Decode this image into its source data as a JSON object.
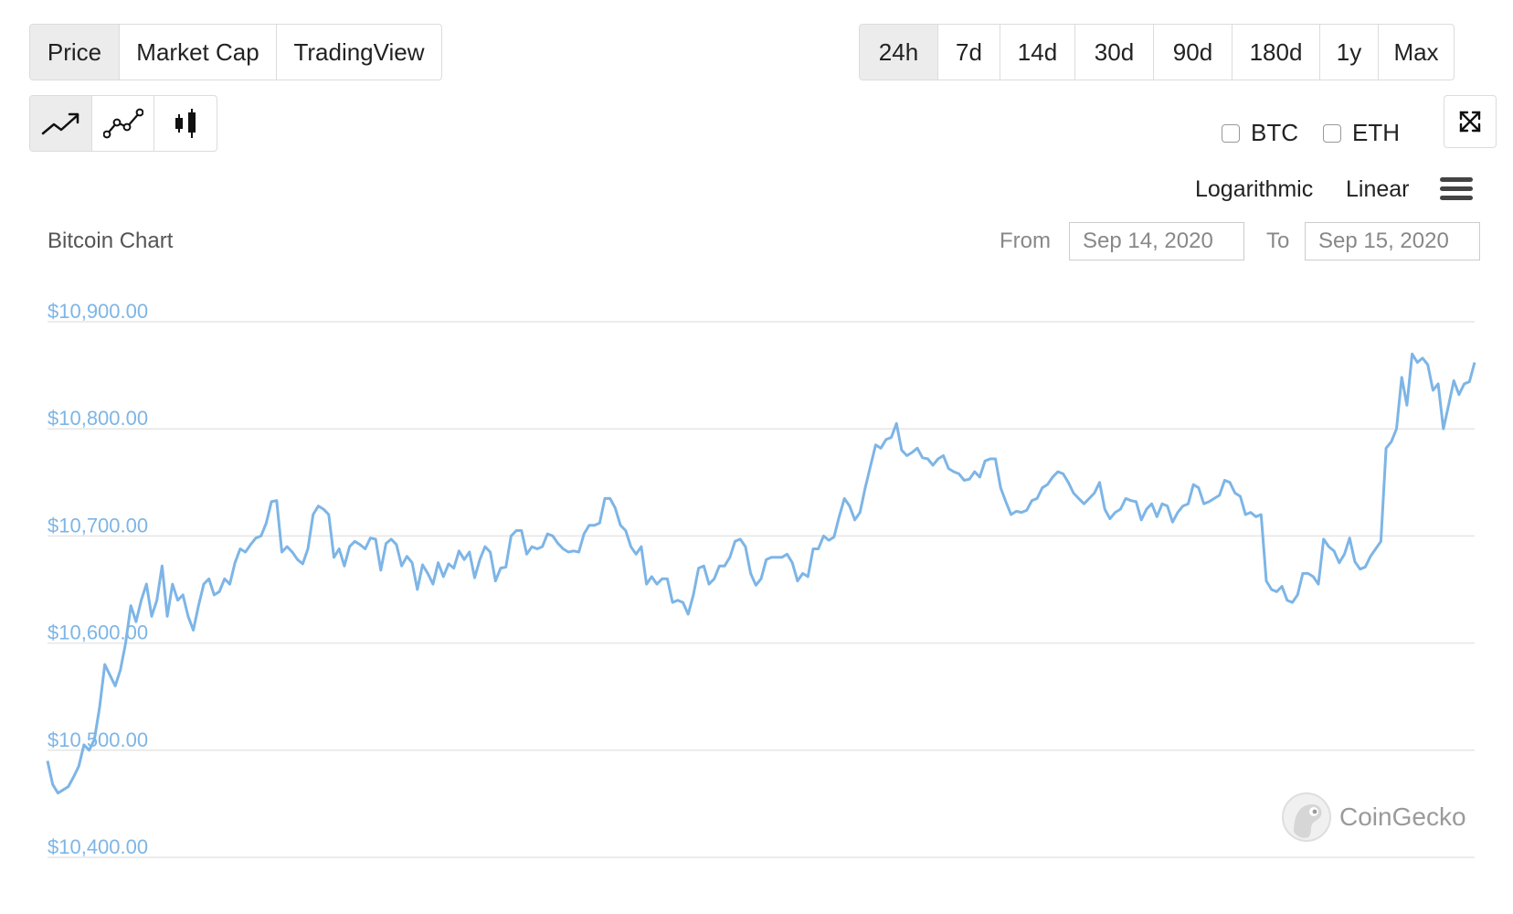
{
  "view_tabs": {
    "items": [
      {
        "label": "Price",
        "active": true
      },
      {
        "label": "Market Cap",
        "active": false
      },
      {
        "label": "TradingView",
        "active": false
      }
    ]
  },
  "range_tabs": {
    "items": [
      {
        "label": "24h",
        "active": true
      },
      {
        "label": "7d",
        "active": false
      },
      {
        "label": "14d",
        "active": false
      },
      {
        "label": "30d",
        "active": false
      },
      {
        "label": "90d",
        "active": false
      },
      {
        "label": "180d",
        "active": false
      },
      {
        "label": "1y",
        "active": false
      },
      {
        "label": "Max",
        "active": false
      }
    ]
  },
  "chart_type_tabs": [
    {
      "icon": "line-chart-icon",
      "active": true
    },
    {
      "icon": "line-points-chart-icon",
      "active": false
    },
    {
      "icon": "candlestick-chart-icon",
      "active": false
    }
  ],
  "compare": {
    "btc_label": "BTC",
    "eth_label": "ETH"
  },
  "scale": {
    "log_label": "Logarithmic",
    "linear_label": "Linear"
  },
  "date_range": {
    "from_label": "From",
    "from_value": "Sep 14, 2020",
    "to_label": "To",
    "to_value": "Sep 15, 2020"
  },
  "watermark": "CoinGecko",
  "colors": {
    "line": "#7db5e6",
    "axis_label": "#7db5e6",
    "grid": "#e6e6e6",
    "active_tab": "#ececec"
  },
  "chart_data": {
    "type": "line",
    "title": "Bitcoin Chart",
    "xlabel": "",
    "ylabel": "",
    "ylim": [
      10400,
      10900
    ],
    "y_ticks": [
      10400,
      10500,
      10600,
      10700,
      10800,
      10900
    ],
    "y_tick_labels": [
      "$10,400.00",
      "$10,500.00",
      "$10,600.00",
      "$10,700.00",
      "$10,800.00",
      "$10,900.00"
    ],
    "grid": true,
    "legend": "none",
    "series": [
      {
        "values": [
          10490,
          10468,
          10460,
          10463,
          10466,
          10475,
          10485,
          10505,
          10500,
          10510,
          10540,
          10580,
          10570,
          10560,
          10575,
          10600,
          10635,
          10620,
          10640,
          10655,
          10625,
          10640,
          10672,
          10625,
          10655,
          10640,
          10645,
          10625,
          10612,
          10635,
          10655,
          10660,
          10645,
          10648,
          10660,
          10655,
          10675,
          10688,
          10685,
          10692,
          10698,
          10700,
          10712,
          10732,
          10733,
          10685,
          10690,
          10685,
          10678,
          10674,
          10688,
          10720,
          10728,
          10725,
          10720,
          10680,
          10688,
          10672,
          10690,
          10695,
          10692,
          10688,
          10698,
          10697,
          10668,
          10693,
          10697,
          10692,
          10672,
          10681,
          10675,
          10650,
          10673,
          10665,
          10655,
          10675,
          10662,
          10674,
          10670,
          10686,
          10678,
          10685,
          10661,
          10678,
          10690,
          10685,
          10658,
          10670,
          10671,
          10700,
          10705,
          10705,
          10683,
          10690,
          10688,
          10690,
          10702,
          10700,
          10693,
          10688,
          10685,
          10686,
          10685,
          10702,
          10710,
          10710,
          10712,
          10735,
          10735,
          10726,
          10710,
          10705,
          10690,
          10683,
          10690,
          10655,
          10662,
          10655,
          10660,
          10660,
          10638,
          10640,
          10638,
          10627,
          10645,
          10670,
          10672,
          10655,
          10660,
          10672,
          10672,
          10680,
          10695,
          10697,
          10690,
          10665,
          10654,
          10660,
          10678,
          10680,
          10680,
          10680,
          10683,
          10675,
          10658,
          10665,
          10662,
          10688,
          10688,
          10700,
          10696,
          10699,
          10718,
          10735,
          10728,
          10715,
          10722,
          10745,
          10765,
          10785,
          10782,
          10790,
          10792,
          10805,
          10780,
          10775,
          10778,
          10782,
          10773,
          10772,
          10766,
          10772,
          10775,
          10763,
          10760,
          10758,
          10752,
          10753,
          10760,
          10755,
          10770,
          10772,
          10772,
          10745,
          10732,
          10720,
          10723,
          10722,
          10724,
          10733,
          10735,
          10745,
          10748,
          10755,
          10760,
          10758,
          10750,
          10740,
          10735,
          10730,
          10735,
          10740,
          10750,
          10725,
          10716,
          10722,
          10725,
          10735,
          10733,
          10732,
          10715,
          10725,
          10730,
          10718,
          10730,
          10728,
          10713,
          10722,
          10728,
          10730,
          10748,
          10745,
          10730,
          10732,
          10735,
          10738,
          10752,
          10750,
          10740,
          10737,
          10720,
          10722,
          10718,
          10720,
          10658,
          10650,
          10648,
          10653,
          10640,
          10638,
          10645,
          10665,
          10665,
          10662,
          10655,
          10697,
          10690,
          10686,
          10675,
          10683,
          10698,
          10676,
          10669,
          10671,
          10681,
          10688,
          10695,
          10782,
          10788,
          10800,
          10848,
          10822,
          10870,
          10862,
          10866,
          10860,
          10836,
          10842,
          10800,
          10822,
          10845,
          10832,
          10842,
          10844,
          10862
        ]
      }
    ]
  }
}
